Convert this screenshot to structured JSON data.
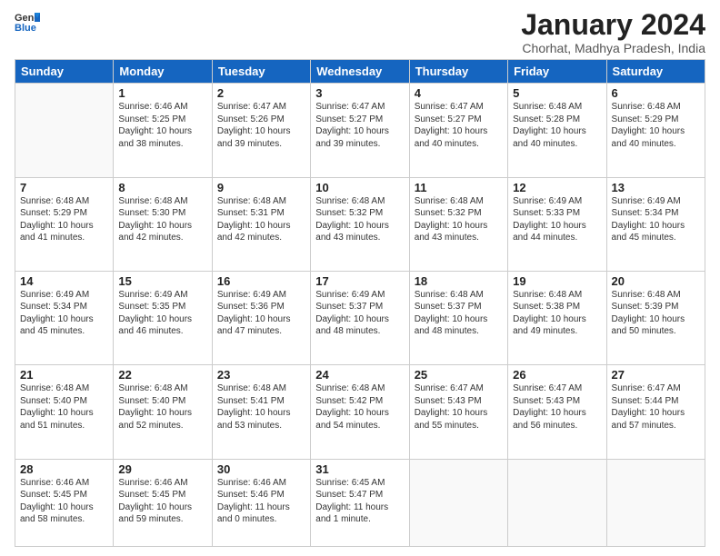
{
  "logo": {
    "general": "General",
    "blue": "Blue"
  },
  "header": {
    "title": "January 2024",
    "subtitle": "Chorhat, Madhya Pradesh, India"
  },
  "weekdays": [
    "Sunday",
    "Monday",
    "Tuesday",
    "Wednesday",
    "Thursday",
    "Friday",
    "Saturday"
  ],
  "weeks": [
    [
      {
        "day": null,
        "info": null
      },
      {
        "day": "1",
        "info": "Sunrise: 6:46 AM\nSunset: 5:25 PM\nDaylight: 10 hours\nand 38 minutes."
      },
      {
        "day": "2",
        "info": "Sunrise: 6:47 AM\nSunset: 5:26 PM\nDaylight: 10 hours\nand 39 minutes."
      },
      {
        "day": "3",
        "info": "Sunrise: 6:47 AM\nSunset: 5:27 PM\nDaylight: 10 hours\nand 39 minutes."
      },
      {
        "day": "4",
        "info": "Sunrise: 6:47 AM\nSunset: 5:27 PM\nDaylight: 10 hours\nand 40 minutes."
      },
      {
        "day": "5",
        "info": "Sunrise: 6:48 AM\nSunset: 5:28 PM\nDaylight: 10 hours\nand 40 minutes."
      },
      {
        "day": "6",
        "info": "Sunrise: 6:48 AM\nSunset: 5:29 PM\nDaylight: 10 hours\nand 40 minutes."
      }
    ],
    [
      {
        "day": "7",
        "info": "Sunrise: 6:48 AM\nSunset: 5:29 PM\nDaylight: 10 hours\nand 41 minutes."
      },
      {
        "day": "8",
        "info": "Sunrise: 6:48 AM\nSunset: 5:30 PM\nDaylight: 10 hours\nand 42 minutes."
      },
      {
        "day": "9",
        "info": "Sunrise: 6:48 AM\nSunset: 5:31 PM\nDaylight: 10 hours\nand 42 minutes."
      },
      {
        "day": "10",
        "info": "Sunrise: 6:48 AM\nSunset: 5:32 PM\nDaylight: 10 hours\nand 43 minutes."
      },
      {
        "day": "11",
        "info": "Sunrise: 6:48 AM\nSunset: 5:32 PM\nDaylight: 10 hours\nand 43 minutes."
      },
      {
        "day": "12",
        "info": "Sunrise: 6:49 AM\nSunset: 5:33 PM\nDaylight: 10 hours\nand 44 minutes."
      },
      {
        "day": "13",
        "info": "Sunrise: 6:49 AM\nSunset: 5:34 PM\nDaylight: 10 hours\nand 45 minutes."
      }
    ],
    [
      {
        "day": "14",
        "info": "Sunrise: 6:49 AM\nSunset: 5:34 PM\nDaylight: 10 hours\nand 45 minutes."
      },
      {
        "day": "15",
        "info": "Sunrise: 6:49 AM\nSunset: 5:35 PM\nDaylight: 10 hours\nand 46 minutes."
      },
      {
        "day": "16",
        "info": "Sunrise: 6:49 AM\nSunset: 5:36 PM\nDaylight: 10 hours\nand 47 minutes."
      },
      {
        "day": "17",
        "info": "Sunrise: 6:49 AM\nSunset: 5:37 PM\nDaylight: 10 hours\nand 48 minutes."
      },
      {
        "day": "18",
        "info": "Sunrise: 6:48 AM\nSunset: 5:37 PM\nDaylight: 10 hours\nand 48 minutes."
      },
      {
        "day": "19",
        "info": "Sunrise: 6:48 AM\nSunset: 5:38 PM\nDaylight: 10 hours\nand 49 minutes."
      },
      {
        "day": "20",
        "info": "Sunrise: 6:48 AM\nSunset: 5:39 PM\nDaylight: 10 hours\nand 50 minutes."
      }
    ],
    [
      {
        "day": "21",
        "info": "Sunrise: 6:48 AM\nSunset: 5:40 PM\nDaylight: 10 hours\nand 51 minutes."
      },
      {
        "day": "22",
        "info": "Sunrise: 6:48 AM\nSunset: 5:40 PM\nDaylight: 10 hours\nand 52 minutes."
      },
      {
        "day": "23",
        "info": "Sunrise: 6:48 AM\nSunset: 5:41 PM\nDaylight: 10 hours\nand 53 minutes."
      },
      {
        "day": "24",
        "info": "Sunrise: 6:48 AM\nSunset: 5:42 PM\nDaylight: 10 hours\nand 54 minutes."
      },
      {
        "day": "25",
        "info": "Sunrise: 6:47 AM\nSunset: 5:43 PM\nDaylight: 10 hours\nand 55 minutes."
      },
      {
        "day": "26",
        "info": "Sunrise: 6:47 AM\nSunset: 5:43 PM\nDaylight: 10 hours\nand 56 minutes."
      },
      {
        "day": "27",
        "info": "Sunrise: 6:47 AM\nSunset: 5:44 PM\nDaylight: 10 hours\nand 57 minutes."
      }
    ],
    [
      {
        "day": "28",
        "info": "Sunrise: 6:46 AM\nSunset: 5:45 PM\nDaylight: 10 hours\nand 58 minutes."
      },
      {
        "day": "29",
        "info": "Sunrise: 6:46 AM\nSunset: 5:45 PM\nDaylight: 10 hours\nand 59 minutes."
      },
      {
        "day": "30",
        "info": "Sunrise: 6:46 AM\nSunset: 5:46 PM\nDaylight: 11 hours\nand 0 minutes."
      },
      {
        "day": "31",
        "info": "Sunrise: 6:45 AM\nSunset: 5:47 PM\nDaylight: 11 hours\nand 1 minute."
      },
      {
        "day": null,
        "info": null
      },
      {
        "day": null,
        "info": null
      },
      {
        "day": null,
        "info": null
      }
    ]
  ]
}
